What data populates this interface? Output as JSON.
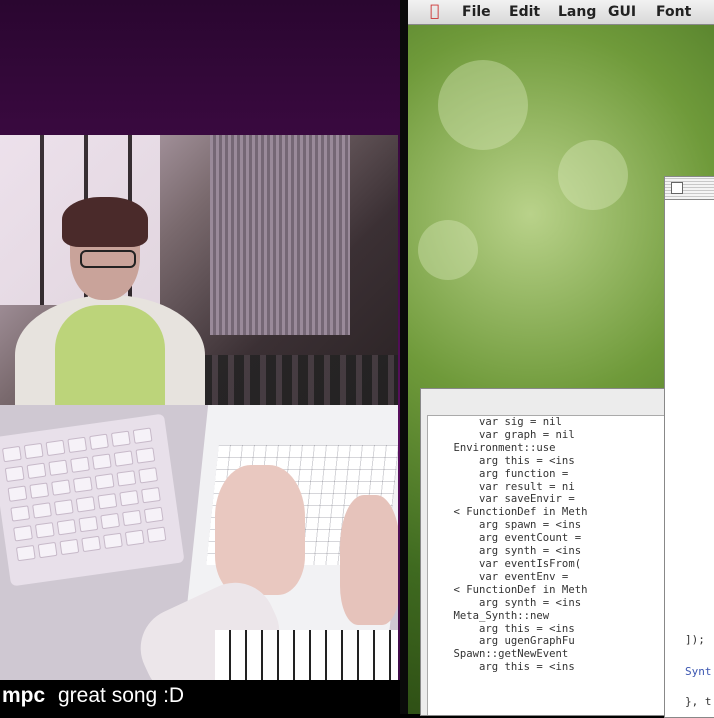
{
  "chat": {
    "username": "mpc",
    "message": "great song :D"
  },
  "menubar": {
    "items": [
      "File",
      "Edit",
      "Lang",
      "GUI",
      "Font"
    ]
  },
  "post_window": {
    "lines": [
      "        var sig = nil",
      "        var graph = nil",
      "    Environment::use",
      "        arg this = <ins",
      "        arg function = ",
      "        var result = ni",
      "        var saveEnvir =",
      "    < FunctionDef in Meth",
      "        arg spawn = <ins",
      "        arg eventCount =",
      "        arg synth = <ins",
      "        var eventIsFrom(",
      "        var eventEnv = ",
      "    < FunctionDef in Meth",
      "        arg synth = <ins",
      "    Meta_Synth::new",
      "        arg this = <ins",
      "        arg ugenGraphFu",
      "    Spawn::getNewEvent",
      "        arg this = <ins"
    ]
  },
  "doc_window": {
    "lines": [
      "]);",
      "Synt",
      "}, t"
    ],
    "synt_color": "#3a55b0"
  }
}
